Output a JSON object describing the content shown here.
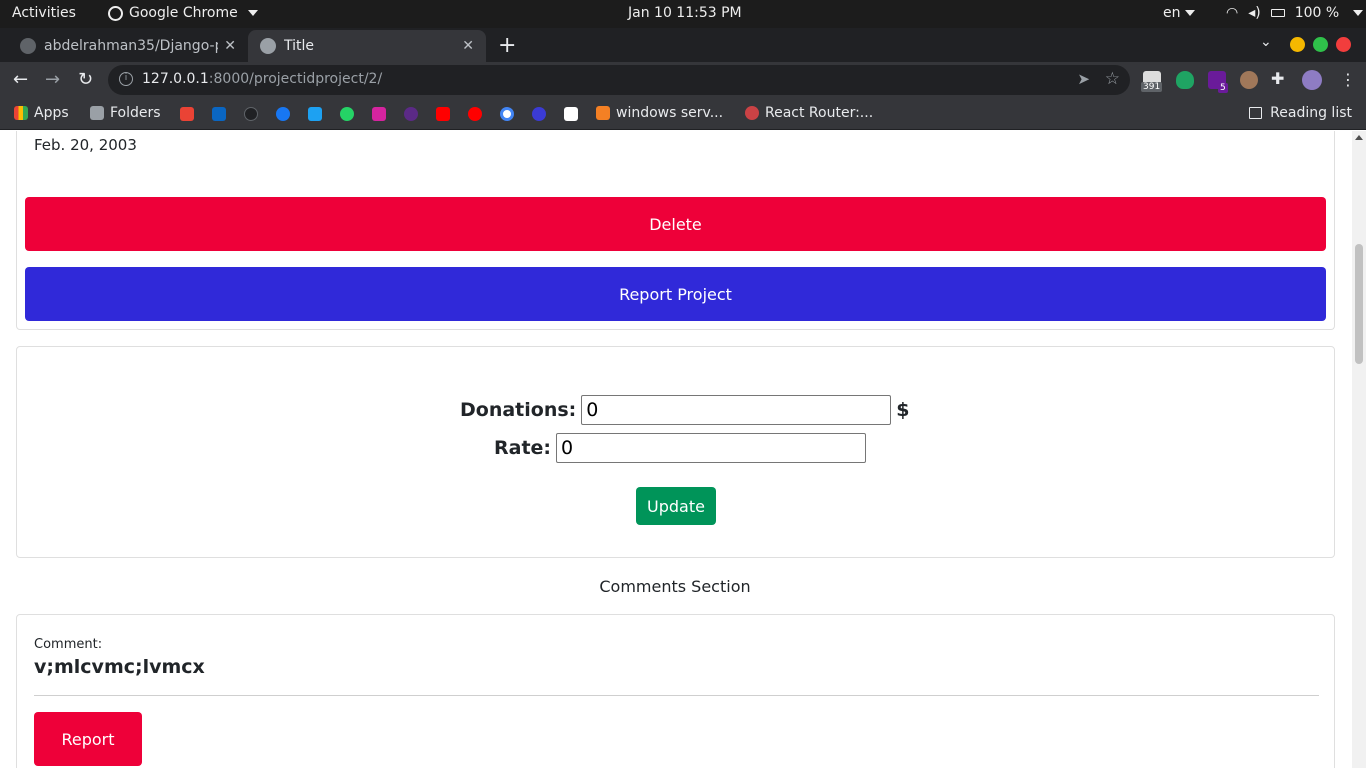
{
  "system_bar": {
    "activities": "Activities",
    "app_name": "Google Chrome",
    "clock": "Jan 10  11:53 PM",
    "language": "en",
    "battery": "100 %"
  },
  "tabs": [
    {
      "title": "abdelrahman35/Django-p",
      "active": false
    },
    {
      "title": "Title",
      "active": true
    }
  ],
  "toolbar": {
    "url_host": "127.0.0.1",
    "url_path": ":8000/projectidproject/2/",
    "extension_badges": {
      "mail": "391",
      "puzzle": "5"
    }
  },
  "bookmarks": {
    "items": [
      {
        "label": "Apps",
        "icon": "apps-grid-icon"
      },
      {
        "label": "Folders",
        "icon": "folder-icon"
      },
      {
        "label": "windows serv...",
        "icon": "stackoverflow-icon"
      },
      {
        "label": "React Router:...",
        "icon": "react-router-icon"
      }
    ],
    "reading_list": "Reading list"
  },
  "project": {
    "date": "Feb. 20, 2003",
    "delete_label": "Delete",
    "report_project_label": "Report Project"
  },
  "donation_form": {
    "donations_label": "Donations:",
    "donations_value": "0",
    "currency": "$",
    "rate_label": "Rate:",
    "rate_value": "0",
    "update_label": "Update"
  },
  "comments": {
    "section_title": "Comments Section",
    "items": [
      {
        "label": "Comment:",
        "text": "v;mlcvmc;lvmcx",
        "report_label": "Report"
      }
    ]
  },
  "colors": {
    "danger": "#ee0039",
    "primary": "#3029d9",
    "success": "#009459"
  }
}
